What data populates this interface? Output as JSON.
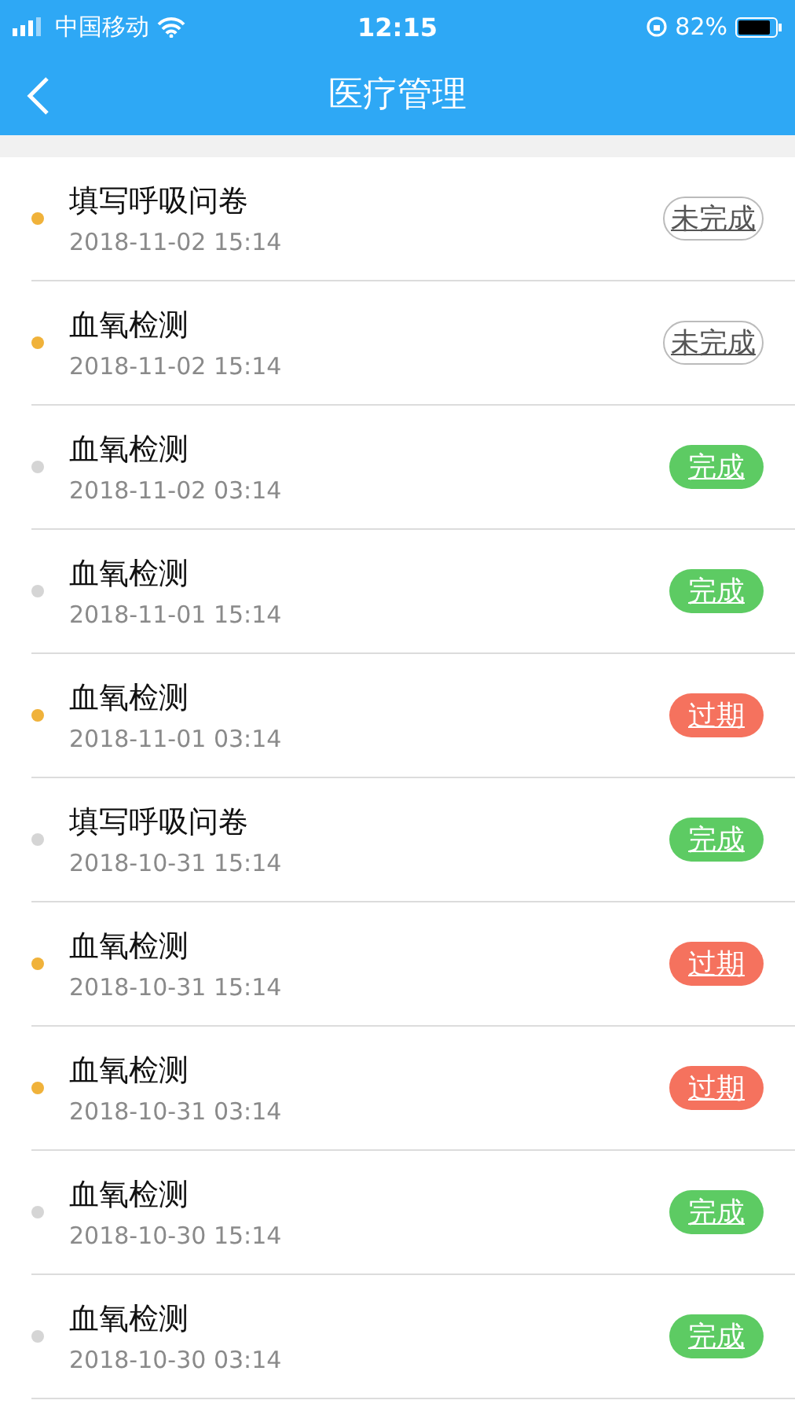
{
  "status_bar": {
    "carrier": "中国移动",
    "time": "12:15",
    "battery": "82%"
  },
  "nav": {
    "title": "医疗管理"
  },
  "rows": [
    {
      "title": "填写呼吸问卷",
      "time": "2018-11-02 15:14",
      "unread": true,
      "status": {
        "kind": "pending",
        "label": "未完成"
      }
    },
    {
      "title": "血氧检测",
      "time": "2018-11-02 15:14",
      "unread": true,
      "status": {
        "kind": "pending",
        "label": "未完成"
      }
    },
    {
      "title": "血氧检测",
      "time": "2018-11-02 03:14",
      "unread": false,
      "status": {
        "kind": "done",
        "label": "完成"
      }
    },
    {
      "title": "血氧检测",
      "time": "2018-11-01 15:14",
      "unread": false,
      "status": {
        "kind": "done",
        "label": "完成"
      }
    },
    {
      "title": "血氧检测",
      "time": "2018-11-01 03:14",
      "unread": true,
      "status": {
        "kind": "expired",
        "label": "过期"
      }
    },
    {
      "title": "填写呼吸问卷",
      "time": "2018-10-31 15:14",
      "unread": false,
      "status": {
        "kind": "done",
        "label": "完成"
      }
    },
    {
      "title": "血氧检测",
      "time": "2018-10-31 15:14",
      "unread": true,
      "status": {
        "kind": "expired",
        "label": "过期"
      }
    },
    {
      "title": "血氧检测",
      "time": "2018-10-31 03:14",
      "unread": true,
      "status": {
        "kind": "expired",
        "label": "过期"
      }
    },
    {
      "title": "血氧检测",
      "time": "2018-10-30 15:14",
      "unread": false,
      "status": {
        "kind": "done",
        "label": "完成"
      }
    },
    {
      "title": "血氧检测",
      "time": "2018-10-30 03:14",
      "unread": false,
      "status": {
        "kind": "done",
        "label": "完成"
      }
    }
  ]
}
